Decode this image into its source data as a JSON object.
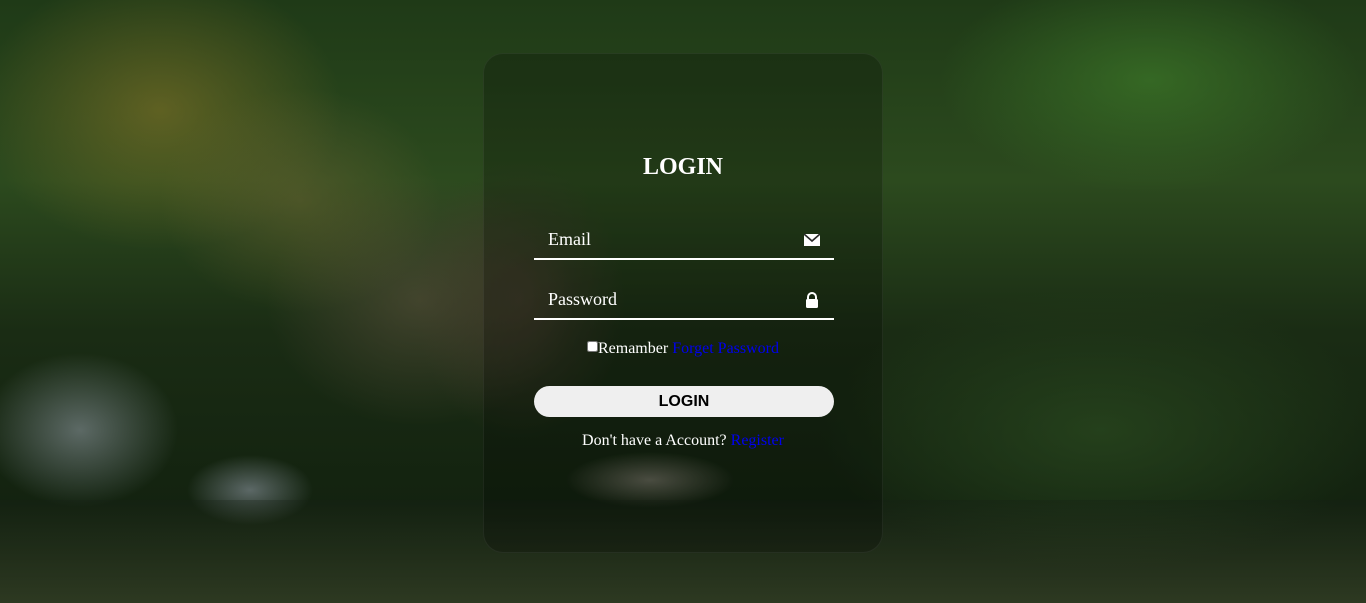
{
  "login_form": {
    "title": "LOGIN",
    "email": {
      "placeholder": "Email",
      "value": "",
      "icon": "envelope-icon"
    },
    "password": {
      "placeholder": "Password",
      "value": "",
      "icon": "lock-icon"
    },
    "remember": {
      "label": "Remamber",
      "checked": false
    },
    "forgot_password_link": "Forget Password",
    "submit_label": "LOGIN",
    "register_prompt": "Don't have a Account?",
    "register_link": "Register"
  },
  "colors": {
    "text": "#ffffff",
    "link": "#0000ee",
    "button_bg": "#efefef",
    "card_overlay": "rgba(0,0,0,0.22)"
  },
  "background": {
    "icon": "river-landscape-photo"
  }
}
